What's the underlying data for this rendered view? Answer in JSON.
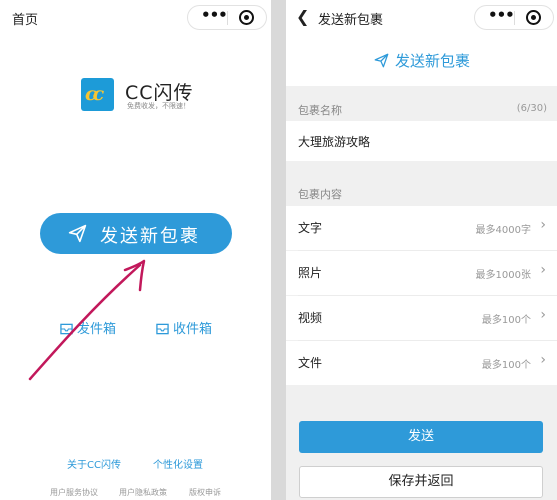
{
  "left": {
    "nav_title": "首页",
    "brand_name": "CC闪传",
    "brand_slogan": "免费收发，不限速！",
    "main_button": "发送新包裹",
    "outbox": "发件箱",
    "inbox": "收件箱",
    "footer_links": [
      "关于CC闪传",
      "个性化设置"
    ],
    "footer_small": [
      "用户服务协议",
      "用户隐私政策",
      "版权申诉"
    ]
  },
  "right": {
    "nav_title": "发送新包裹",
    "header_title": "发送新包裹",
    "name_section_label": "包裹名称",
    "name_counter": "(6/30)",
    "name_value": "大理旅游攻略",
    "content_section_label": "包裹内容",
    "rows": [
      {
        "label": "文字",
        "hint": "最多4000字"
      },
      {
        "label": "照片",
        "hint": "最多1000张"
      },
      {
        "label": "视频",
        "hint": "最多100个"
      },
      {
        "label": "文件",
        "hint": "最多100个"
      }
    ],
    "send_button": "发送",
    "save_button": "保存并返回"
  },
  "colors": {
    "accent": "#2e9ad9",
    "annotation": "#c2185b",
    "logo_yellow": "#f7c531"
  },
  "icons": [
    "paper-plane-icon",
    "outbox-icon",
    "inbox-icon",
    "more-dots-icon",
    "target-icon",
    "back-chevron-icon",
    "chevron-right-icon"
  ]
}
